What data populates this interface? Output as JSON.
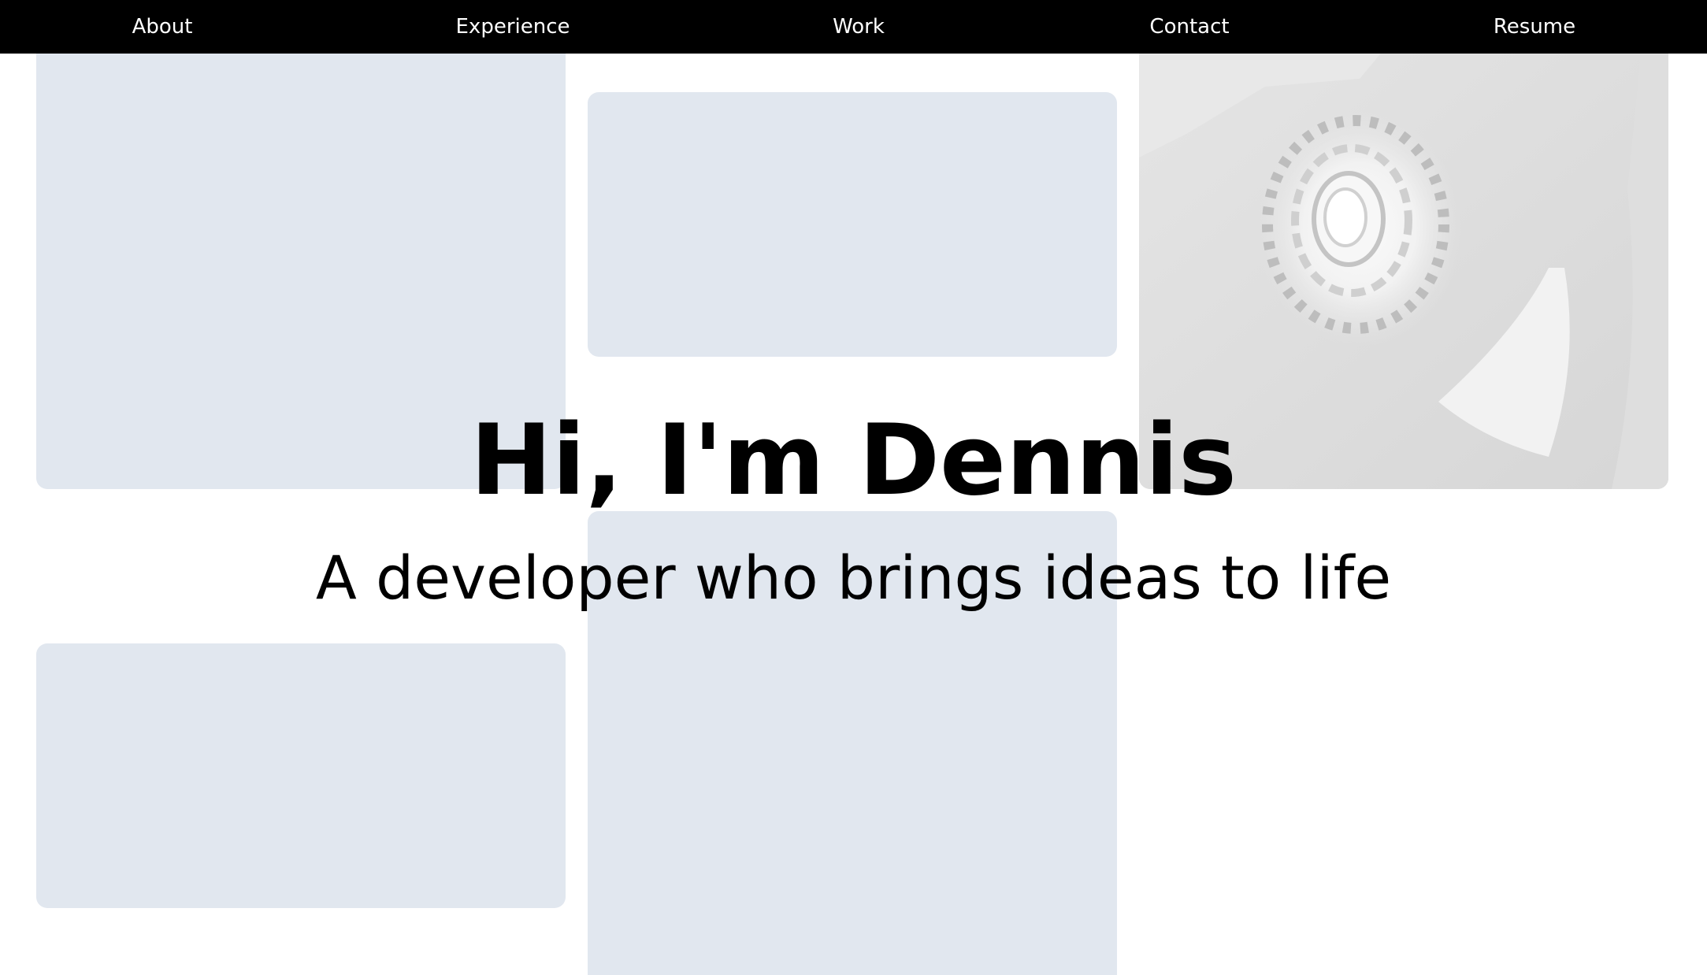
{
  "nav": {
    "items": [
      {
        "label": "About"
      },
      {
        "label": "Experience"
      },
      {
        "label": "Work"
      },
      {
        "label": "Contact"
      },
      {
        "label": "Resume"
      }
    ]
  },
  "hero": {
    "title": "Hi, I'm Dennis",
    "subtitle": "A developer who brings ideas to life"
  },
  "colors": {
    "nav_background": "#000000",
    "nav_text": "#ffffff",
    "tile_background": "#e1e7ef",
    "photo_tile_background": "#e5e5e5",
    "text": "#000000",
    "page_background": "#ffffff"
  }
}
